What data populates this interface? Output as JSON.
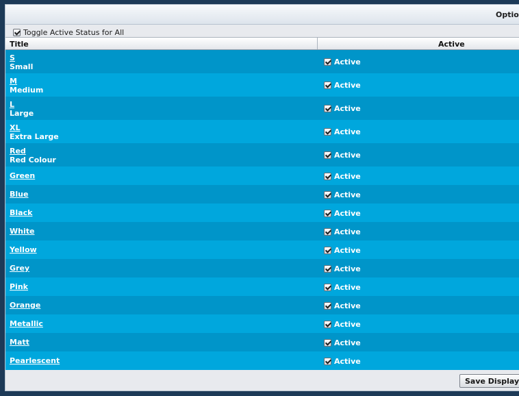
{
  "header": {
    "title": "Option"
  },
  "toggle": {
    "label": "Toggle Active Status for All",
    "checked": true
  },
  "columns": {
    "title": "Title",
    "active": "Active"
  },
  "rows": [
    {
      "code": "S",
      "description": "Small",
      "active_label": "Active",
      "checked": true
    },
    {
      "code": "M",
      "description": "Medium",
      "active_label": "Active",
      "checked": true
    },
    {
      "code": "L",
      "description": "Large",
      "active_label": "Active",
      "checked": true
    },
    {
      "code": "XL",
      "description": "Extra Large",
      "active_label": "Active",
      "checked": true
    },
    {
      "code": "Red",
      "description": "Red Colour",
      "active_label": "Active",
      "checked": true
    },
    {
      "code": "Green",
      "description": "",
      "active_label": "Active",
      "checked": true
    },
    {
      "code": "Blue",
      "description": "",
      "active_label": "Active",
      "checked": true
    },
    {
      "code": "Black",
      "description": "",
      "active_label": "Active",
      "checked": true
    },
    {
      "code": "White",
      "description": "",
      "active_label": "Active",
      "checked": true
    },
    {
      "code": "Yellow",
      "description": "",
      "active_label": "Active",
      "checked": true
    },
    {
      "code": "Grey",
      "description": "",
      "active_label": "Active",
      "checked": true
    },
    {
      "code": "Pink",
      "description": "",
      "active_label": "Active",
      "checked": true
    },
    {
      "code": "Orange",
      "description": "",
      "active_label": "Active",
      "checked": true
    },
    {
      "code": "Metallic",
      "description": "",
      "active_label": "Active",
      "checked": true
    },
    {
      "code": "Matt",
      "description": "",
      "active_label": "Active",
      "checked": true
    },
    {
      "code": "Pearlescent",
      "description": "",
      "active_label": "Active",
      "checked": true
    }
  ],
  "footer": {
    "save_label": "Save Display O"
  },
  "colors": {
    "row_dark": "#0095c9",
    "row_light": "#00a7dd",
    "frame": "#1d3a57"
  }
}
